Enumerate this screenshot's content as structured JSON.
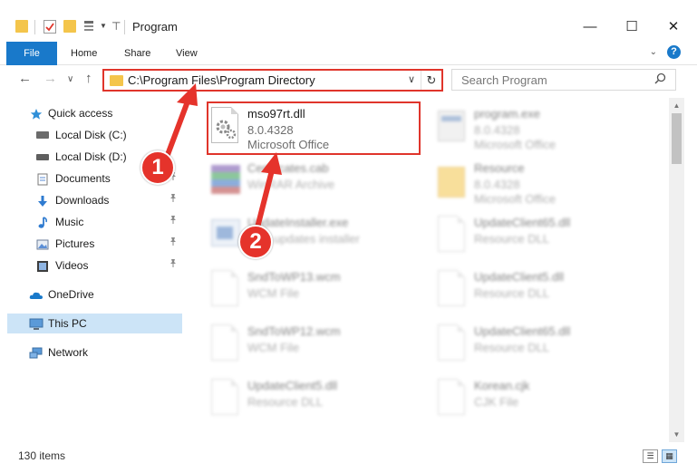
{
  "window": {
    "title": "Program",
    "minimize": "—",
    "maximize": "☐",
    "close": "✕"
  },
  "ribbon": {
    "tabs": [
      "File",
      "Home",
      "Share",
      "View"
    ],
    "expand_glyph": "⌄",
    "help_glyph": "?"
  },
  "address": {
    "path": "C:\\Program Files\\Program Directory",
    "dropdown_glyph": "∨",
    "refresh_glyph": "↻"
  },
  "search": {
    "placeholder": "Search Program",
    "icon": "search-icon"
  },
  "nav": {
    "back": "←",
    "forward": "→",
    "recent": "∨",
    "up": "↑",
    "items": [
      {
        "label": "Quick access",
        "icon": "star-icon"
      },
      {
        "label": "Local Disk (C:)",
        "icon": "drive-icon"
      },
      {
        "label": "Local Disk (D:)",
        "icon": "drive-icon"
      },
      {
        "label": "Documents",
        "icon": "documents-icon"
      },
      {
        "label": "Downloads",
        "icon": "downloads-icon"
      },
      {
        "label": "Music",
        "icon": "music-icon"
      },
      {
        "label": "Pictures",
        "icon": "pictures-icon"
      },
      {
        "label": "Videos",
        "icon": "videos-icon"
      },
      {
        "label": "OneDrive",
        "icon": "onedrive-icon"
      },
      {
        "label": "This PC",
        "icon": "computer-icon"
      },
      {
        "label": "Network",
        "icon": "network-icon"
      }
    ],
    "pin_glyph": "📌"
  },
  "files": [
    {
      "name": "mso97rt.dll",
      "line2": "8.0.4328",
      "line3": "Microsoft Office",
      "icon": "dll-gear-icon"
    },
    {
      "name": "program.exe",
      "line2": "8.0.4328",
      "line3": "Microsoft Office",
      "icon": "exe-icon"
    },
    {
      "name": "Certificates.cab",
      "line2": "WinRAR Archive",
      "icon": "archive-icon"
    },
    {
      "name": "Resource",
      "line2": "8.0.4328",
      "line3": "Microsoft Office",
      "icon": "folder-icon"
    },
    {
      "name": "UpdateInstaller.exe",
      "line2": "DAY updates installer",
      "icon": "installer-icon"
    },
    {
      "name": "UpdateClient65.dll",
      "line2": "Resource DLL",
      "icon": "dll-gear-icon"
    },
    {
      "name": "SndToWP13.wcm",
      "line2": "WCM File",
      "icon": "blank-file-icon"
    },
    {
      "name": "UpdateClient5.dll",
      "line2": "Resource DLL",
      "icon": "dll-gear-icon"
    },
    {
      "name": "SndToWP12.wcm",
      "line2": "WCM File",
      "icon": "blank-file-icon"
    },
    {
      "name": "UpdateClient65.dll",
      "line2": "Resource DLL",
      "icon": "dll-gear-icon"
    },
    {
      "name": "UpdateClient5.dll",
      "line2": "Resource DLL",
      "icon": "dll-gear-icon"
    },
    {
      "name": "Korean.cjk",
      "line2": "CJK File",
      "icon": "blank-file-icon"
    }
  ],
  "callouts": [
    "1",
    "2"
  ],
  "status": {
    "item_count": "130 items"
  },
  "colors": {
    "accent": "#1979ca",
    "highlight": "#e0352b",
    "selection": "#cce4f7"
  }
}
